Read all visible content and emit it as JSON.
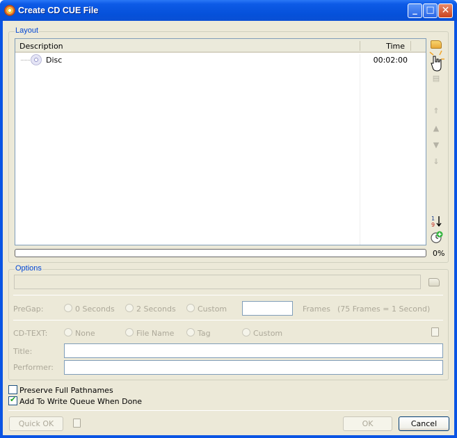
{
  "window": {
    "title": "Create CD CUE File"
  },
  "titlebar_buttons": {
    "minimize": "_",
    "maximize": "□",
    "close": "✕"
  },
  "layout": {
    "legend": "Layout",
    "columns": {
      "description": "Description",
      "time": "Time"
    },
    "items": [
      {
        "label": "Disc",
        "time": "00:02:00"
      }
    ],
    "progress": {
      "value": 0,
      "text": "0%"
    }
  },
  "options": {
    "legend": "Options",
    "pregap": {
      "label": "PreGap:",
      "options": [
        "0 Seconds",
        "2 Seconds",
        "Custom"
      ],
      "frames_label": "Frames",
      "frames_note": "(75 Frames = 1 Second)"
    },
    "cdtext": {
      "label": "CD-TEXT:",
      "options": [
        "None",
        "File Name",
        "Tag",
        "Custom"
      ]
    },
    "title_label": "Title:",
    "performer_label": "Performer:"
  },
  "checkboxes": [
    {
      "label": "Preserve Full Pathnames",
      "checked": false
    },
    {
      "label": "Add To Write Queue When Done",
      "checked": true
    }
  ],
  "buttons": {
    "quick_ok": "Quick OK",
    "ok": "OK",
    "cancel": "Cancel"
  }
}
